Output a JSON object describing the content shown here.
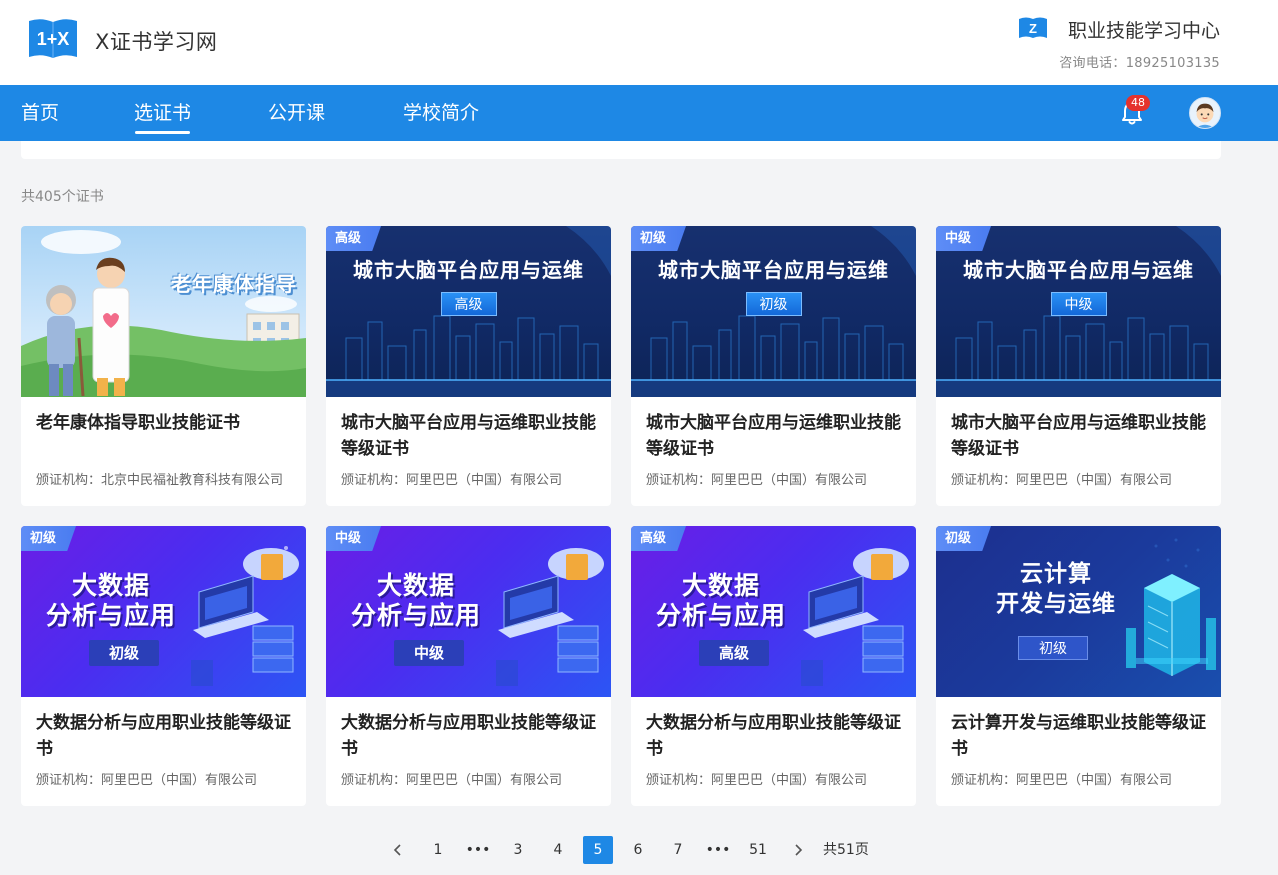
{
  "header": {
    "logo_text": "1+X",
    "site_title": "X证书学习网",
    "center_title": "职业技能学习中心",
    "hotline": "咨询电话：18925103135"
  },
  "nav": {
    "items": [
      {
        "label": "首页",
        "active": false
      },
      {
        "label": "选证书",
        "active": true
      },
      {
        "label": "公开课",
        "active": false
      },
      {
        "label": "学校简介",
        "active": false
      }
    ],
    "notification_count": "48"
  },
  "main": {
    "total_text": "共405个证书"
  },
  "cards": [
    {
      "kind": "elder",
      "level_tag": "",
      "banner_title": "老年康体指导",
      "banner_level": "",
      "title": "老年康体指导职业技能证书",
      "org": "颁证机构：北京中民福祉教育科技有限公司"
    },
    {
      "kind": "city",
      "level_tag": "高级",
      "banner_title": "城市大脑平台应用与运维",
      "banner_level": "高级",
      "title": "城市大脑平台应用与运维职业技能等级证书",
      "org": "颁证机构：阿里巴巴（中国）有限公司"
    },
    {
      "kind": "city",
      "level_tag": "初级",
      "banner_title": "城市大脑平台应用与运维",
      "banner_level": "初级",
      "title": "城市大脑平台应用与运维职业技能等级证书",
      "org": "颁证机构：阿里巴巴（中国）有限公司"
    },
    {
      "kind": "city",
      "level_tag": "中级",
      "banner_title": "城市大脑平台应用与运维",
      "banner_level": "中级",
      "title": "城市大脑平台应用与运维职业技能等级证书",
      "org": "颁证机构：阿里巴巴（中国）有限公司"
    },
    {
      "kind": "data",
      "level_tag": "初级",
      "banner_title_1": "大数据",
      "banner_title_2": "分析与应用",
      "banner_level": "初级",
      "title": "大数据分析与应用职业技能等级证书",
      "org": "颁证机构：阿里巴巴（中国）有限公司"
    },
    {
      "kind": "data",
      "level_tag": "中级",
      "banner_title_1": "大数据",
      "banner_title_2": "分析与应用",
      "banner_level": "中级",
      "title": "大数据分析与应用职业技能等级证书",
      "org": "颁证机构：阿里巴巴（中国）有限公司"
    },
    {
      "kind": "data",
      "level_tag": "高级",
      "banner_title_1": "大数据",
      "banner_title_2": "分析与应用",
      "banner_level": "高级",
      "title": "大数据分析与应用职业技能等级证书",
      "org": "颁证机构：阿里巴巴（中国）有限公司"
    },
    {
      "kind": "cloud",
      "level_tag": "初级",
      "banner_title_1": "云计算",
      "banner_title_2": "开发与运维",
      "banner_level": "初级",
      "title": "云计算开发与运维职业技能等级证书",
      "org": "颁证机构：阿里巴巴（中国）有限公司"
    }
  ],
  "pagination": {
    "prev_icon": "chevron-left-icon",
    "next_icon": "chevron-right-icon",
    "items": [
      "1",
      "•••",
      "3",
      "4",
      "5",
      "6",
      "7",
      "•••",
      "51"
    ],
    "current": "5",
    "total_text": "共51页"
  },
  "colors": {
    "primary": "#1e88e5",
    "badge": "#e5322d",
    "page_bg": "#f3f4f6"
  }
}
